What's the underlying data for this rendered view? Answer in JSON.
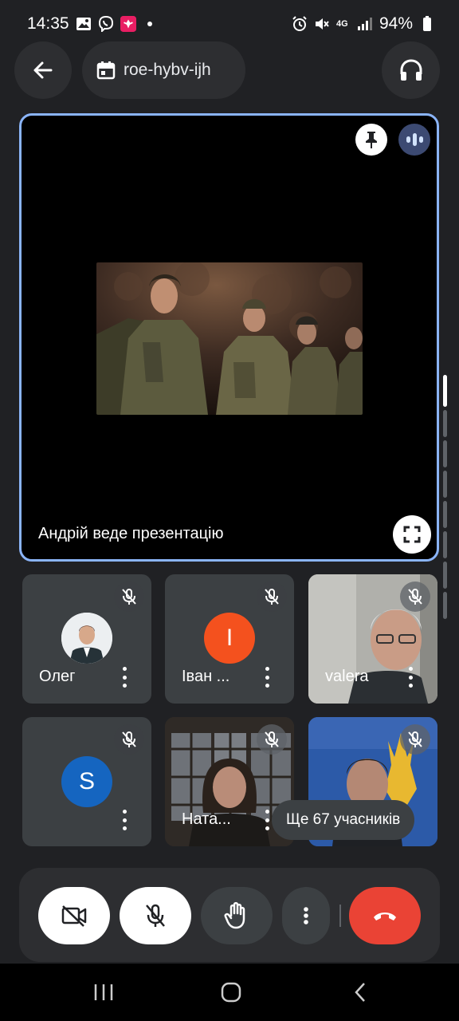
{
  "status_bar": {
    "time": "14:35",
    "battery": "94%",
    "network_label": "4G",
    "icons": [
      "gallery-icon",
      "viber-icon",
      "app-icon",
      "notification-dot",
      "alarm-icon",
      "mute-icon",
      "signal-icon",
      "battery-icon"
    ]
  },
  "header": {
    "meeting_code": "roe-hybv-ijh",
    "back_icon": "arrow-left-icon",
    "calendar_icon": "calendar-icon",
    "audio_icon": "headphones-icon"
  },
  "presentation": {
    "presenter_label": "Андрій веде презентацію",
    "pin_icon": "pin-icon",
    "speaking_icon": "speaking-indicator-icon",
    "fullscreen_icon": "fullscreen-icon",
    "accent_color": "#8ab4f8"
  },
  "participants": [
    {
      "name": "Олег",
      "type": "photo-avatar",
      "muted": true
    },
    {
      "name": "Іван ...",
      "type": "initial-avatar",
      "initial": "I",
      "color": "#f4511e",
      "muted": true
    },
    {
      "name": "valera",
      "type": "video",
      "muted": true
    },
    {
      "name": "",
      "type": "initial-avatar",
      "initial": "S",
      "color": "#1565c0",
      "muted": true
    },
    {
      "name": "Ната...",
      "type": "video",
      "muted": true
    },
    {
      "name": "",
      "type": "video",
      "muted": true
    }
  ],
  "more_participants": "Ще 67 учасників",
  "controls": {
    "camera_icon": "camera-off-icon",
    "mic_icon": "mic-off-icon",
    "hand_icon": "raise-hand-icon",
    "more_icon": "more-vertical-icon",
    "end_icon": "end-call-icon",
    "end_color": "#ea4335"
  },
  "nav": {
    "recents_icon": "recents-icon",
    "home_icon": "home-icon",
    "back_icon": "back-chevron-icon"
  }
}
